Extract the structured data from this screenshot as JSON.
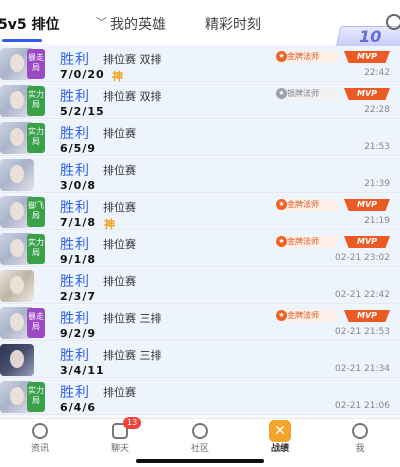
{
  "header": {
    "tabs": [
      {
        "label": "5v5 排位"
      },
      {
        "label": "我的英雄"
      },
      {
        "label": "精彩时刻"
      }
    ],
    "badge_text": "10"
  },
  "matches": [
    {
      "tag": "暴走局",
      "result": "胜利",
      "mode": "排位赛 双排",
      "kda": "7/0/20",
      "shen": "神",
      "medal": "金牌法师",
      "mvp": "MVP",
      "time": "22:42"
    },
    {
      "tag": "实力局",
      "result": "胜利",
      "mode": "排位赛 双排",
      "kda": "5/2/15",
      "shen": "",
      "medal": "银牌法师",
      "mvp": "MVP",
      "time": "22:28"
    },
    {
      "tag": "实力局",
      "result": "胜利",
      "mode": "排位赛",
      "kda": "6/5/9",
      "shen": "",
      "medal": "",
      "mvp": "",
      "time": "21:53"
    },
    {
      "tag": "",
      "result": "胜利",
      "mode": "排位赛",
      "kda": "3/0/8",
      "shen": "",
      "medal": "",
      "mvp": "",
      "time": "21:39"
    },
    {
      "tag": "御飞局",
      "result": "胜利",
      "mode": "排位赛",
      "kda": "7/1/8",
      "shen": "神",
      "medal": "金牌法师",
      "mvp": "MVP",
      "time": "21:19"
    },
    {
      "tag": "实力局",
      "result": "胜利",
      "mode": "排位赛",
      "kda": "9/1/8",
      "shen": "",
      "medal": "金牌法师",
      "mvp": "MVP",
      "time": "02-21 23:02"
    },
    {
      "tag": "",
      "result": "胜利",
      "mode": "排位赛",
      "kda": "2/3/7",
      "shen": "",
      "medal": "",
      "mvp": "",
      "time": "02-21 22:42"
    },
    {
      "tag": "暴走局",
      "result": "胜利",
      "mode": "排位赛 三排",
      "kda": "9/2/9",
      "shen": "",
      "medal": "金牌法师",
      "mvp": "MVP",
      "time": "02-21 21:53"
    },
    {
      "tag": "",
      "result": "胜利",
      "mode": "排位赛 三排",
      "kda": "3/4/11",
      "shen": "",
      "medal": "",
      "mvp": "",
      "time": "02-21 21:34"
    },
    {
      "tag": "实力局",
      "result": "胜利",
      "mode": "排位赛",
      "kda": "6/4/6",
      "shen": "",
      "medal": "",
      "mvp": "",
      "time": "02-21 21:06"
    }
  ],
  "bottom_nav": [
    {
      "label": "资讯",
      "icon": "news-icon"
    },
    {
      "label": "聊天",
      "icon": "chat-icon",
      "badge": "13"
    },
    {
      "label": "社区",
      "icon": "community-icon"
    },
    {
      "label": "战绩",
      "icon": "record-icon",
      "active": true
    },
    {
      "label": "我",
      "icon": "profile-icon"
    }
  ],
  "colors": {
    "accent": "#2f63e0",
    "win": "#2f63e0",
    "mvp": "#ea5a22",
    "active_nav": "#f3a52a"
  }
}
